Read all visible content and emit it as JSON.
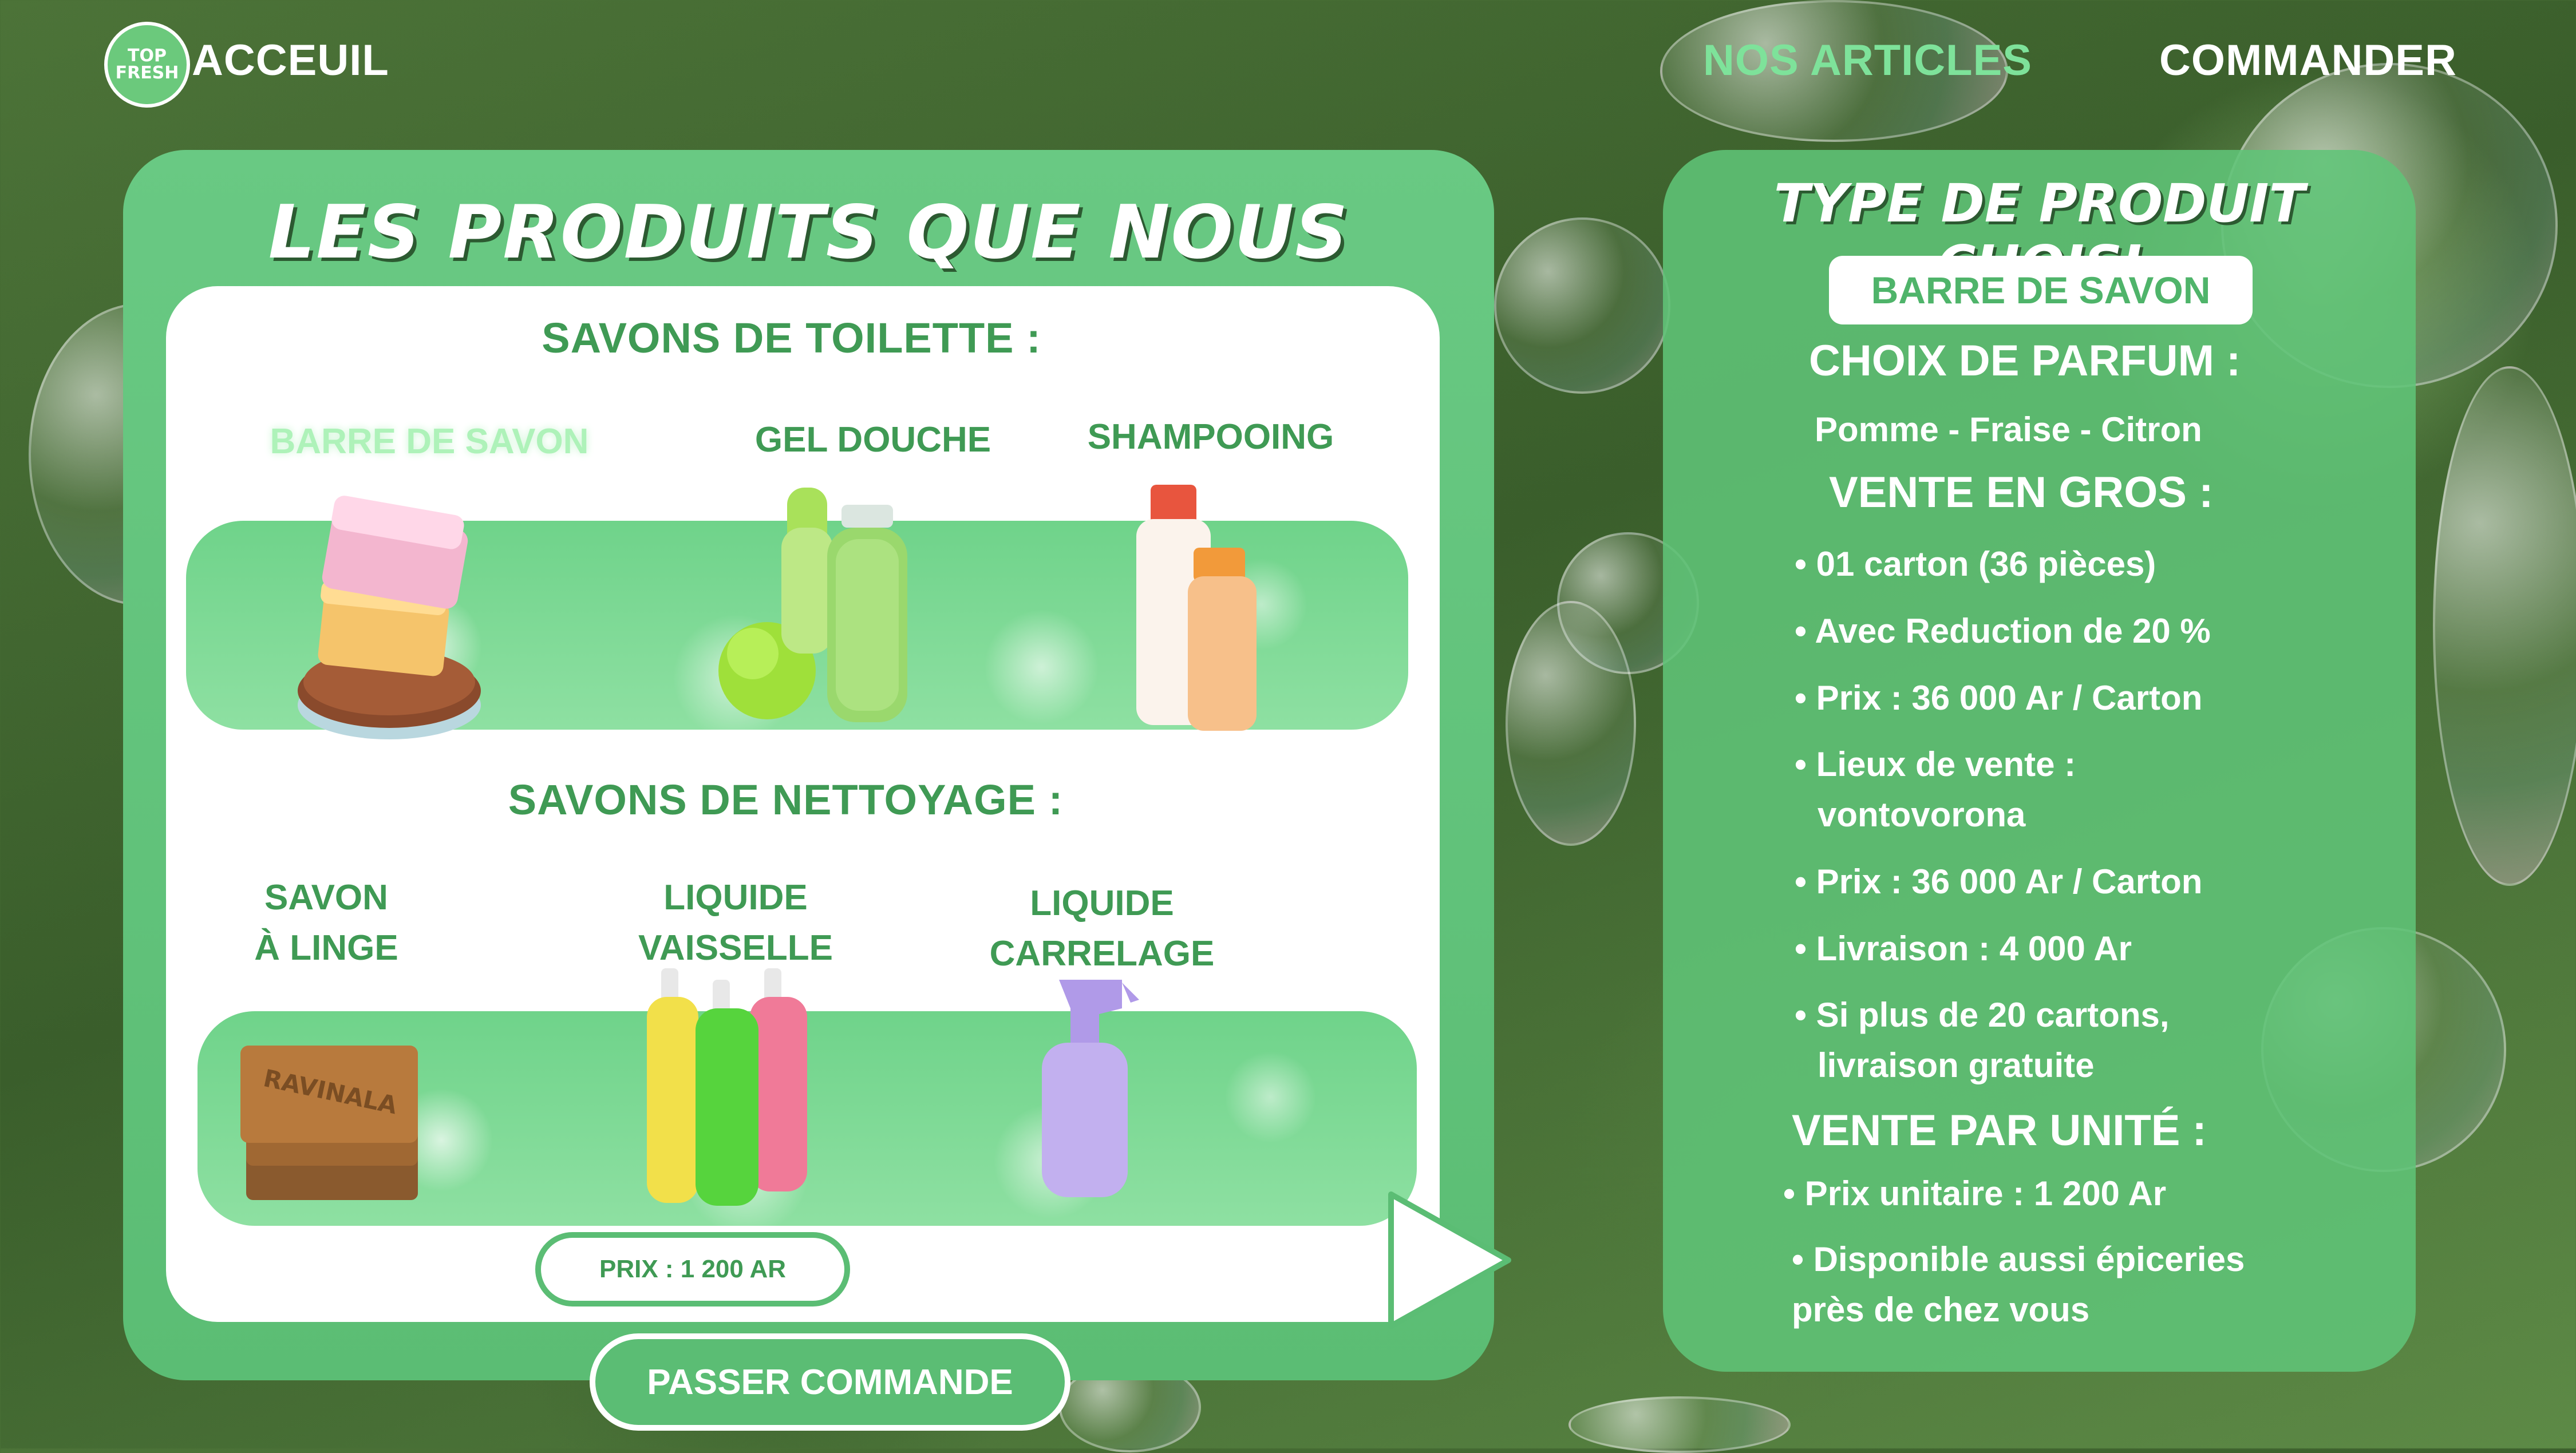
{
  "nav": {
    "logo_line1": "TOP",
    "logo_line2": "FRESH",
    "home": "ACCEUIL",
    "articles": "NOS ARTICLES",
    "order": "COMMANDER"
  },
  "catalog": {
    "title": "LES PRODUITS QUE NOUS PROPOSONS :",
    "toilet_section": "SAVONS DE TOILETTE :",
    "cleaning_section": "SAVONS DE NETTOYAGE :",
    "toilet_products": [
      {
        "label": "BARRE DE SAVON",
        "selected": true
      },
      {
        "label": "GEL DOUCHE",
        "selected": false
      },
      {
        "label": "SHAMPOOING",
        "selected": false
      }
    ],
    "cleaning_products": [
      {
        "line1": "SAVON",
        "line2": "À LINGE"
      },
      {
        "line1": "LIQUIDE",
        "line2": "VAISSELLE"
      },
      {
        "line1": "LIQUIDE",
        "line2": "CARRELAGE"
      }
    ],
    "price": "PRIX :  1 200 AR",
    "cta": "PASSER COMMANDE",
    "soap_stamp": "RAVINALA"
  },
  "details": {
    "title": "TYPE DE PRODUIT CHOISI",
    "chosen": "BARRE DE SAVON",
    "scent_heading": "CHOIX DE PARFUM :",
    "scents": "Pomme - Fraise - Citron",
    "wholesale_heading": "VENTE EN GROS :",
    "wholesale_items": [
      "• 01 carton (36 pièces)",
      "• Avec Reduction de 20 %",
      "• Prix : 36 000 Ar / Carton",
      "• Lieux de vente :",
      "vontovorona",
      "• Prix : 36 000 Ar / Carton",
      "• Livraison : 4 000 Ar",
      "• Si plus de 20 cartons,",
      "livraison gratuite"
    ],
    "unit_heading": "VENTE PAR UNITÉ :",
    "unit_items": [
      "• Prix unitaire : 1 200 Ar",
      "• Disponible aussi épiceries",
      "près de chez vous"
    ]
  },
  "colors": {
    "panel_green": "#5bbd74",
    "text_green": "#3f9a54",
    "active_nav": "#7ee29a"
  }
}
